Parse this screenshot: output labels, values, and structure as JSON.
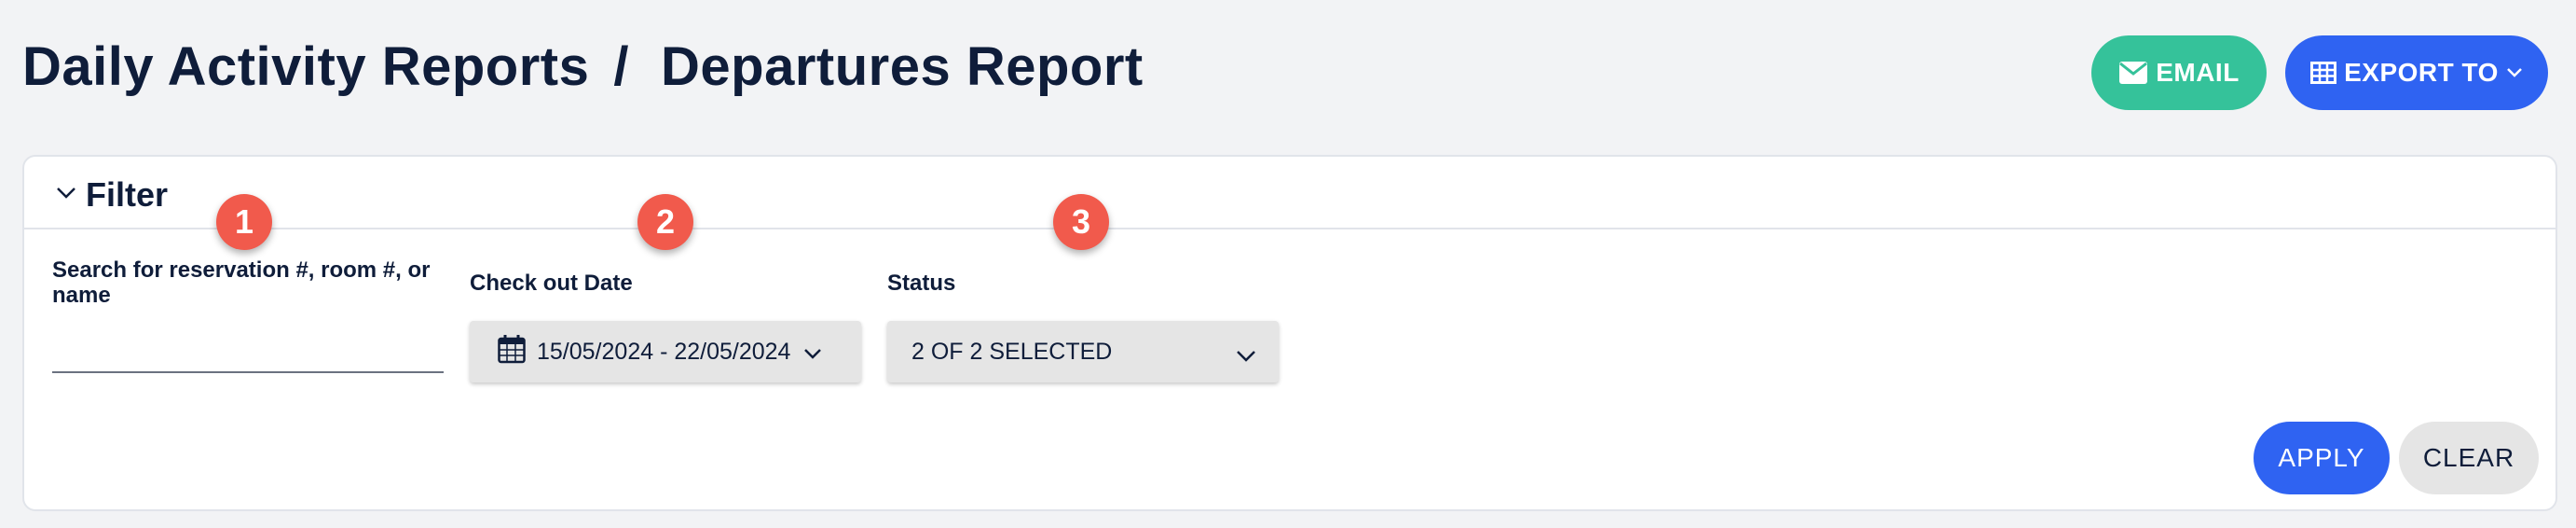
{
  "header": {
    "breadcrumb_parent": "Daily Activity Reports",
    "breadcrumb_separator": "/",
    "breadcrumb_current": "Departures Report",
    "email_label": "EMAIL",
    "export_label": "EXPORT TO"
  },
  "filter": {
    "title": "Filter",
    "search": {
      "label": "Search for reservation #, room #, or name",
      "value": "",
      "placeholder": ""
    },
    "checkout_date": {
      "label": "Check out Date",
      "value": "15/05/2024 - 22/05/2024"
    },
    "status": {
      "label": "Status",
      "value": "2 OF 2 SELECTED"
    },
    "apply_label": "APPLY",
    "clear_label": "CLEAR"
  },
  "markers": [
    "1",
    "2",
    "3"
  ],
  "colors": {
    "title": "#0f1d3a",
    "email_button": "#35c29a",
    "primary_button": "#2f63f2",
    "marker": "#f15a4c",
    "background": "#f2f3f5"
  },
  "icons": [
    "envelope-icon",
    "table-icon",
    "chevron-down-icon",
    "calendar-icon"
  ]
}
